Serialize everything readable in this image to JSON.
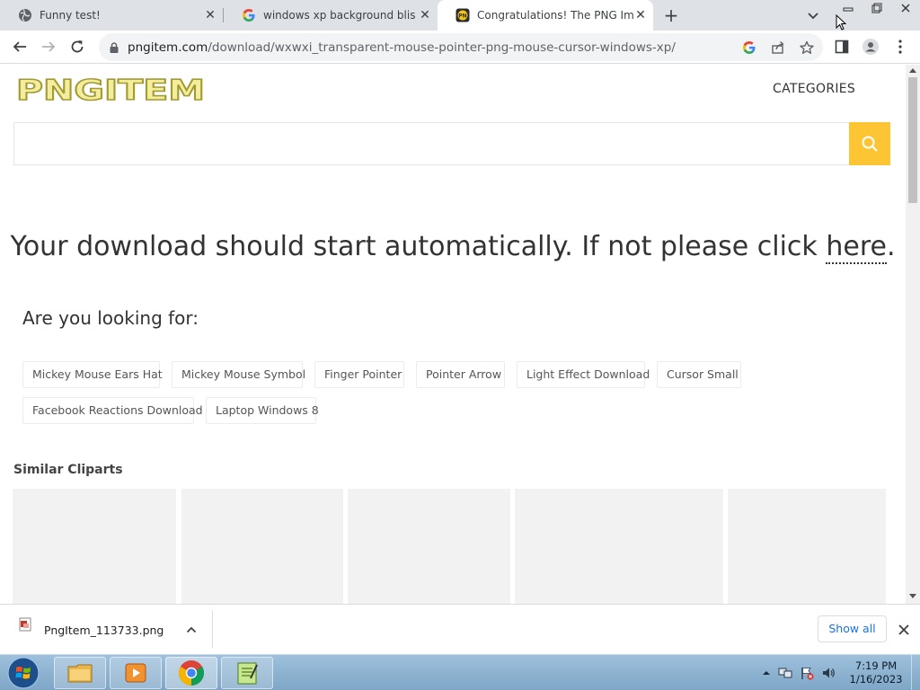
{
  "browser": {
    "tabs": [
      {
        "title": "Funny test!",
        "favicon": "globe-icon"
      },
      {
        "title": "windows xp background bliss - G",
        "favicon": "google-icon"
      },
      {
        "title": "Congratulations! The PNG Image",
        "favicon": "pngitem-icon"
      }
    ],
    "url_host": "pngitem.com",
    "url_path": "/download/wxwxi_transparent-mouse-pointer-png-mouse-cursor-windows-xp/"
  },
  "site": {
    "logo_text": "PNGITEM",
    "nav_categories": "CATEGORIES",
    "search_value": "",
    "search_placeholder": "",
    "colors": {
      "accent": "#fdc533",
      "logo_fill": "#f3ee9e",
      "logo_stroke": "#a39a31"
    }
  },
  "download_message": {
    "text": "Your download should start automatically. If not please click ",
    "link": "here",
    "end": "."
  },
  "looking_for": {
    "heading": "Are you looking for:",
    "tags": [
      "Mickey Mouse Ears Hat",
      "Mickey Mouse Symbol",
      "Finger Pointer",
      "Pointer Arrow",
      "Light Effect Download",
      "Cursor Small",
      "Facebook Reactions Download",
      "Laptop Windows 8"
    ]
  },
  "similar": {
    "heading": "Similar Cliparts"
  },
  "download_bar": {
    "file_name": "PngItem_113733.png",
    "show_all": "Show all"
  },
  "taskbar": {
    "time": "7:19 PM",
    "date": "1/16/2023",
    "apps": [
      "folder-icon",
      "media-player-icon",
      "chrome-icon",
      "notepad-icon"
    ]
  }
}
